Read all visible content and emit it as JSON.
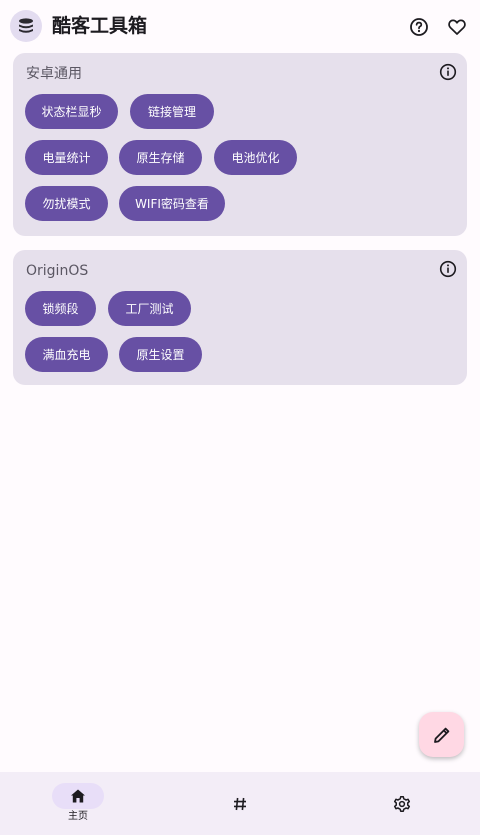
{
  "app": {
    "title": "酷客工具箱",
    "logo_icon": "stack-icon",
    "accent_color": "#6750a4",
    "card_color": "#e6e0ec",
    "fab_color": "#ffd8e4"
  },
  "topbar": {
    "help_icon": "help-circle-icon",
    "favorite_icon": "heart-outline-icon"
  },
  "sections": [
    {
      "title": "安卓通用",
      "info_icon": "info-icon",
      "items": [
        "状态栏显秒",
        "链接管理",
        "电量统计",
        "原生存储",
        "电池优化",
        "勿扰模式",
        "WIFI密码查看"
      ]
    },
    {
      "title": "OriginOS",
      "info_icon": "info-icon",
      "items": [
        "锁频段",
        "工厂测试",
        "满血充电",
        "原生设置"
      ]
    }
  ],
  "fab": {
    "icon": "pencil-icon"
  },
  "bottom_nav": {
    "items": [
      {
        "label": "主页",
        "icon": "home-icon",
        "selected": true
      },
      {
        "label": "",
        "icon": "hash-icon",
        "selected": false
      },
      {
        "label": "",
        "icon": "gear-icon",
        "selected": false
      }
    ]
  }
}
